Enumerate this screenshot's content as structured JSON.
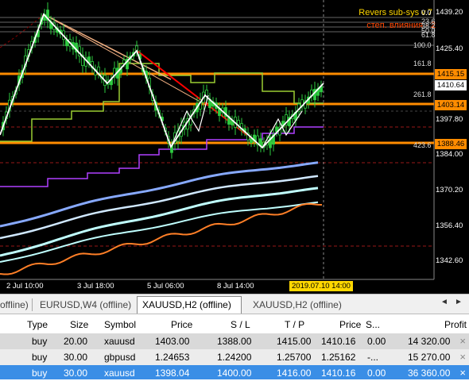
{
  "indicator": {
    "title": "Revers sub-sys v.7",
    "subtitle": "степ. влияния - 2",
    "title_value": "0.0"
  },
  "fib_levels": [
    "23.6",
    "38.2",
    "50.0",
    "61.8",
    "100.0",
    "161.8",
    "261.8",
    "423.6"
  ],
  "price_axis": [
    "1439.20",
    "1425.40",
    "1397.80",
    "1384.00",
    "1370.20",
    "1356.40",
    "1342.60"
  ],
  "price_boxes": [
    {
      "text": "1415.15",
      "bg": "#ff8c00",
      "fg": "#000000"
    },
    {
      "text": "1410.64",
      "bg": "#ffffff",
      "fg": "#000000"
    },
    {
      "text": "1403.14",
      "bg": "#ff8c00",
      "fg": "#000000"
    },
    {
      "text": "1388.46",
      "bg": "#ff8c00",
      "fg": "#000000"
    }
  ],
  "time_axis": [
    "2 Jul 10:00",
    "3 Jul 18:00",
    "5 Jul 06:00",
    "8 Jul 14:00"
  ],
  "cursor_time": "2019.07.10 14:00",
  "colors": {
    "chart_bg": "#000000",
    "candle_bull": "#2ecc40",
    "zigzag": "#ffffff",
    "fib_line": "#f4b183",
    "downtrend_line": "#ff0000",
    "orange_level": "#ff8c00",
    "ma_fast": "#9acd32",
    "ma_slow": "#b040ff",
    "band_blue": "#87a9ff",
    "band_light": "#d0e8ff",
    "band_cyan": "#c0ffff",
    "band_orange": "#ff7f27"
  },
  "tabs": {
    "left_fragment": "offline)",
    "items": [
      "EURUSD,W4 (offline)",
      "XAUUSD,H2 (offline)",
      "XAUUSD,H2 (offline)"
    ],
    "active_index": 1,
    "prev_icon": "◄",
    "next_icon": "►"
  },
  "table": {
    "headers": [
      "Type",
      "Size",
      "Symbol",
      "Price",
      "S / L",
      "T / P",
      "Price",
      "S...",
      "Profit"
    ],
    "rows": [
      [
        "buy",
        "20.00",
        "xauusd",
        "1403.00",
        "1388.00",
        "1415.00",
        "1410.16",
        "0.00",
        "14 320.00"
      ],
      [
        "buy",
        "30.00",
        "gbpusd",
        "1.24653",
        "1.24200",
        "1.25700",
        "1.25162",
        "-...",
        "15 270.00"
      ],
      [
        "buy",
        "30.00",
        "xauusd",
        "1398.04",
        "1400.00",
        "1416.00",
        "1410.16",
        "0.00",
        "36 360.00"
      ]
    ],
    "close_icon": "×"
  }
}
